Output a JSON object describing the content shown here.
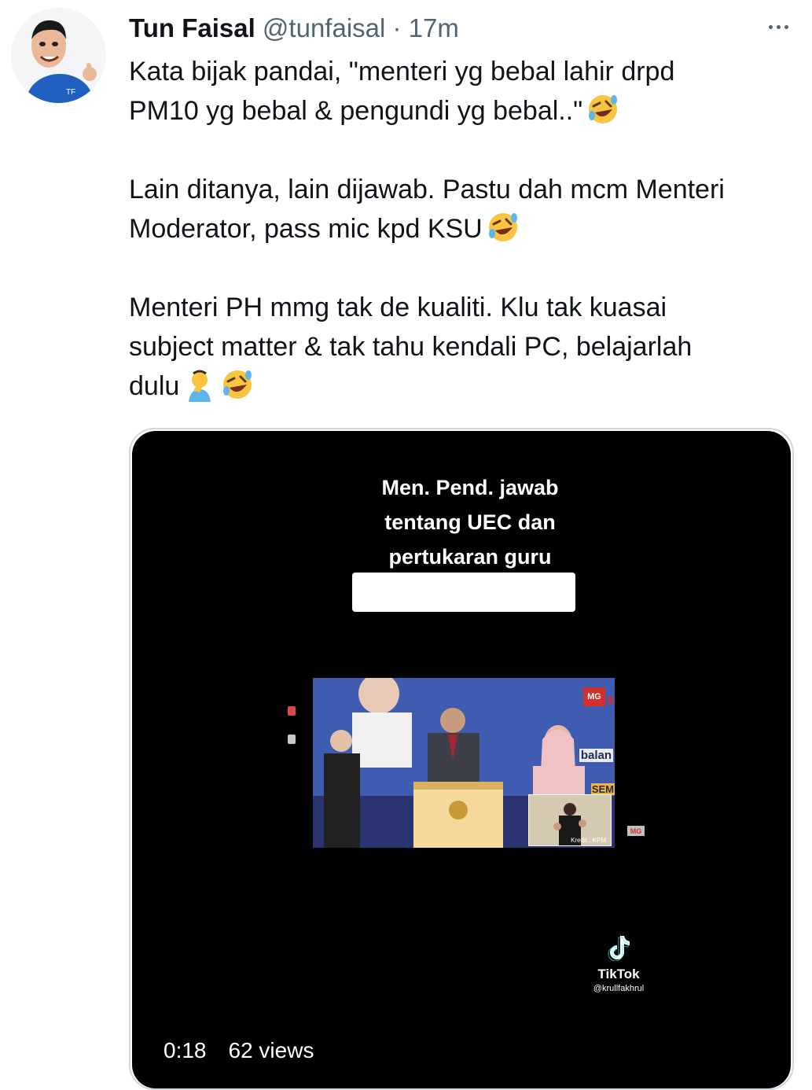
{
  "tweet": {
    "author_name": "Tun Faisal",
    "handle": "@tunfaisal",
    "separator": "·",
    "time": "17m",
    "paragraphs": [
      [
        "Kata bijak pandai, \"menteri yg bebal lahir drpd",
        "PM10 yg bebal & pengundi yg bebal..\""
      ],
      [
        "Lain ditanya, lain dijawab. Pastu dah mcm Menteri",
        "Moderator, pass mic kpd KSU"
      ],
      [
        "Menteri PH mmg tak de kualiti. Klu tak kuasai",
        "subject matter & tak tahu kendali PC, belajarlah",
        "dulu"
      ]
    ],
    "emojis": [
      "rolling-on-floor-laughing",
      "rolling-on-floor-laughing",
      "facepalm",
      "rolling-on-floor-laughing"
    ]
  },
  "video": {
    "caption_lines": [
      "Men. Pend. jawab",
      "tentang UEC dan",
      "pertukaran guru"
    ],
    "logo_text": "MG",
    "logo_suffix": "B",
    "banner_word": "balan",
    "banner_word_2": "SEM",
    "credit": "Kredit : KPM",
    "small_logo": "MG",
    "tiktok_brand": "TikTok",
    "tiktok_user": "@krullfakhrul",
    "duration": "0:18",
    "views": "62 views"
  },
  "colors": {
    "text": "#0f1419",
    "secondary": "#536471",
    "border": "#cfd9de",
    "video_bg": "#000000"
  }
}
